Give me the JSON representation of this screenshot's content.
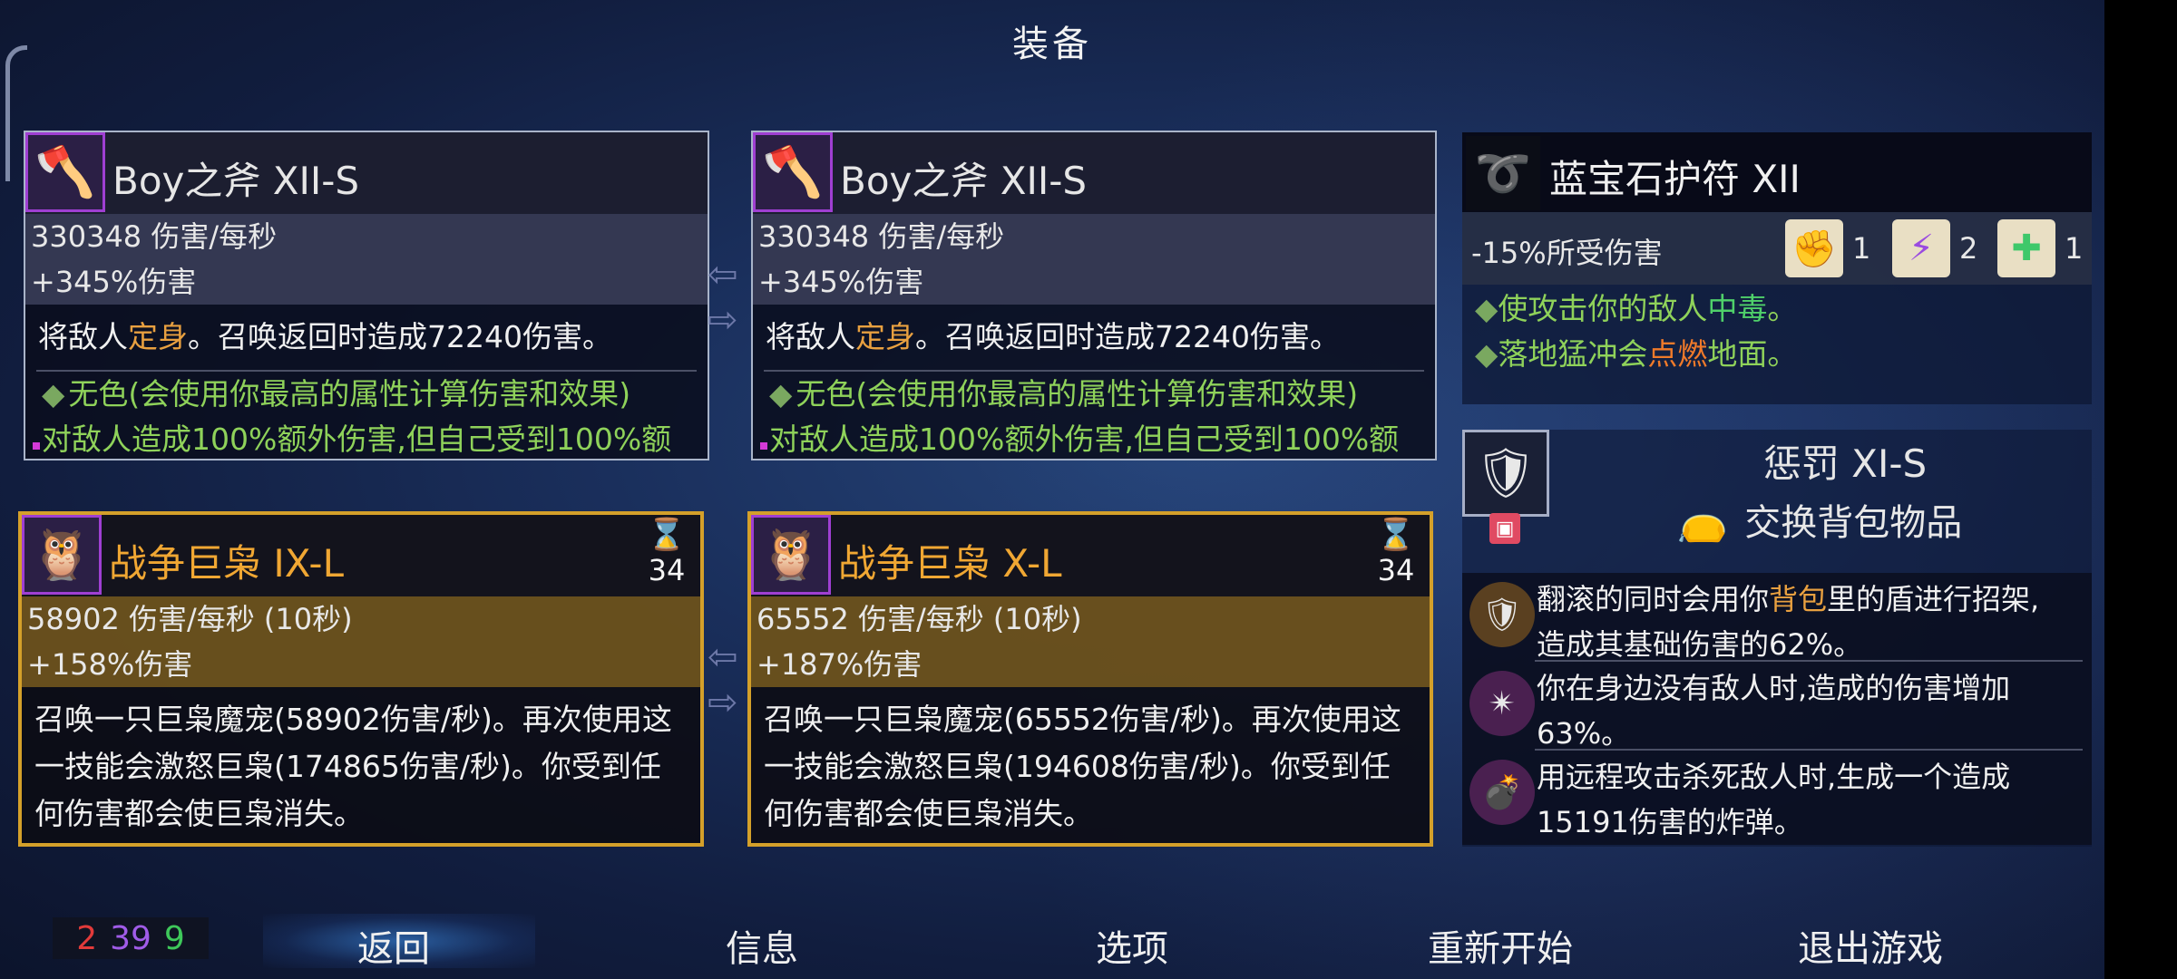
{
  "title": "装备",
  "weapons": [
    {
      "name": "Boy之斧 XII-S",
      "icon": "axe-icon",
      "dps": "330348 伤害/每秒",
      "bonus": "+345%伤害",
      "desc_pre": "将敌人",
      "desc_hl": "定身",
      "desc_post": "。召唤返回时造成72240伤害。",
      "perk1": "无色(会使用你最高的属性计算伤害和效果)",
      "perk2": "对敌人造成100%额外伤害,但自己受到100%额"
    },
    {
      "name": "Boy之斧 XII-S",
      "icon": "axe-icon",
      "dps": "330348 伤害/每秒",
      "bonus": "+345%伤害",
      "desc_pre": "将敌人",
      "desc_hl": "定身",
      "desc_post": "。召唤返回时造成72240伤害。",
      "perk1": "无色(会使用你最高的属性计算伤害和效果)",
      "perk2": "对敌人造成100%额外伤害,但自己受到100%额"
    }
  ],
  "skills": [
    {
      "name": "战争巨枭 IX-L",
      "icon": "owl-icon",
      "cooldown": "34",
      "dps": "58902 伤害/每秒 (10秒)",
      "bonus": "+158%伤害",
      "desc_l1": "召唤一只巨枭魔宠(58902伤害/秒)。再次使用这",
      "desc_l2": "一技能会激怒巨枭(174865伤害/秒)。你受到任",
      "desc_l3": "何伤害都会使巨枭消失。"
    },
    {
      "name": "战争巨枭 X-L",
      "icon": "owl-icon",
      "cooldown": "34",
      "dps": "65552 伤害/每秒 (10秒)",
      "bonus": "+187%伤害",
      "desc_l1": "召唤一只巨枭魔宠(65552伤害/秒)。再次使用这",
      "desc_l2": "一技能会激怒巨枭(194608伤害/秒)。你受到任",
      "desc_l3": "何伤害都会使巨枭消失。"
    }
  ],
  "amulet": {
    "name": "蓝宝石护符 XII",
    "stat": "-15%所受伤害",
    "scrolls": [
      {
        "icon": "red-fist-scroll-icon",
        "count": "1",
        "color": "#d83a3a"
      },
      {
        "icon": "purple-bolt-scroll-icon",
        "count": "2",
        "color": "#9a4ae0"
      },
      {
        "icon": "green-cross-scroll-icon",
        "count": "1",
        "color": "#3ec86a"
      }
    ],
    "perk1_pre": "使攻击你的敌人",
    "perk1_hl": "中毒",
    "perk1_post": "。",
    "perk2_pre": "落地猛冲会",
    "perk2_hl": "点燃",
    "perk2_post": "地面。"
  },
  "punish": {
    "name": "惩罚 XI-S",
    "swap_label": "交换背包物品",
    "rows": [
      {
        "l1_pre": "翻滚的同时会用你",
        "l1_hl": "背包",
        "l1_post": "里的盾进行招架,",
        "l2": "造成其基础伤害的62%。"
      },
      {
        "l1": "你在身边没有敌人时,造成的伤害增加",
        "l2": "63%。"
      },
      {
        "l1": "用远程攻击杀死敌人时,生成一个造成",
        "l2": "15191伤害的炸弹。"
      }
    ]
  },
  "counters": {
    "red": "2",
    "purple": "39",
    "green": "9"
  },
  "nav": {
    "back": "返回",
    "info": "信息",
    "options": "选项",
    "restart": "重新开始",
    "quit": "退出游戏"
  },
  "colors": {
    "highlight_orange": "#e8a040",
    "perk_green": "#8fd25a",
    "gold_border": "#d4a02a",
    "rarity_purple": "#9f3fd2"
  }
}
